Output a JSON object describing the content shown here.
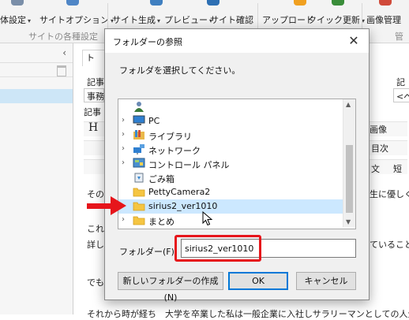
{
  "ribbon": {
    "items": [
      {
        "label": "体設定",
        "id": "r0"
      },
      {
        "label": "サイトオプション",
        "id": "r1"
      },
      {
        "label": "サイト生成",
        "id": "r2"
      },
      {
        "label": "プレビュー",
        "id": "r3"
      },
      {
        "label": "サイト確認",
        "id": "r4"
      },
      {
        "label": "アップロード",
        "id": "r5"
      },
      {
        "label": "クイック更新",
        "id": "r6"
      },
      {
        "label": "画像管理",
        "id": "r7"
      }
    ],
    "groups": [
      {
        "label": "サイトの各種設定"
      },
      {
        "label": "管"
      }
    ],
    "chevron": "▾"
  },
  "left_panel": {
    "collapse_glyph": "‹"
  },
  "background": {
    "tab_label": "ト",
    "texts": [
      {
        "text": "記事",
        "id": "t0"
      },
      {
        "text": "事務",
        "id": "t1"
      },
      {
        "text": "記事",
        "id": "t2"
      },
      {
        "text": "H",
        "id": "t3"
      },
      {
        "text": "その",
        "id": "t4"
      },
      {
        "text": "これ",
        "id": "t5"
      },
      {
        "text": "詳し",
        "id": "t6"
      },
      {
        "text": "でも",
        "id": "t7"
      },
      {
        "text": "記",
        "id": "t8"
      },
      {
        "text": "<ペ",
        "id": "t9"
      },
      {
        "text": "画像",
        "id": "t10"
      },
      {
        "text": "目次",
        "id": "t11"
      },
      {
        "text": "文",
        "id": "t12"
      },
      {
        "text": "短",
        "id": "t13"
      },
      {
        "text": "生に優しく",
        "id": "t14"
      },
      {
        "text": "ていることは",
        "id": "t15"
      },
      {
        "text": "それから時が経ち　大学を卒業した私は一般企業に入社しサラリーマンとしての人生をスタ",
        "id": "t16"
      }
    ]
  },
  "dialog": {
    "title": "フォルダーの参照",
    "close_glyph": "✕",
    "instruction": "フォルダを選択してください。",
    "tree": [
      {
        "label": "",
        "icon": "user-icon"
      },
      {
        "label": "PC",
        "icon": "pc-icon"
      },
      {
        "label": "ライブラリ",
        "icon": "library-icon"
      },
      {
        "label": "ネットワーク",
        "icon": "network-icon"
      },
      {
        "label": "コントロール パネル",
        "icon": "control-panel-icon"
      },
      {
        "label": "ごみ箱",
        "icon": "recycle-bin-icon"
      },
      {
        "label": "PettyCamera2",
        "icon": "folder-icon"
      },
      {
        "label": "sirius2_ver1010",
        "icon": "folder-icon",
        "selected": true
      },
      {
        "label": "まとめ",
        "icon": "folder-icon"
      }
    ],
    "expander_glyph": "›",
    "folder_label": "フォルダー(F):",
    "folder_value": "sirius2_ver1010",
    "buttons": {
      "new_folder": "新しいフォルダーの作成(N)",
      "ok": "OK",
      "cancel": "キャンセル"
    },
    "scroll_up": "▲",
    "scroll_down": "▼"
  },
  "colors": {
    "annotation_red": "#e6151b",
    "selection_blue": "#cce8ff",
    "ok_border": "#0078d7"
  }
}
